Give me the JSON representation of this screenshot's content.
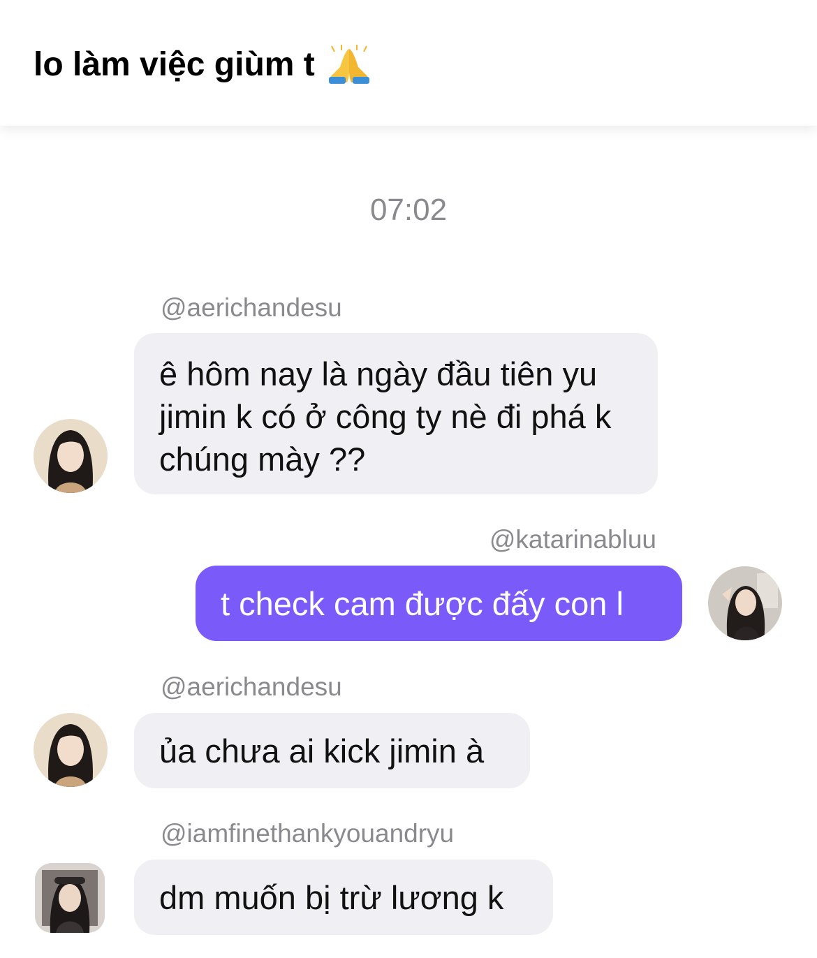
{
  "header": {
    "title": "lo làm việc giùm t",
    "emoji_icon": "folded-hands-icon"
  },
  "timestamp": "07:02",
  "messages": [
    {
      "username": "@aerichandesu",
      "text": "ê hôm nay là ngày đầu tiên yu jimin k có ở công ty nè đi phá k chúng mày ??",
      "direction": "incoming"
    },
    {
      "username": "@katarinabluu",
      "text": "t check cam được đấy con l",
      "direction": "outgoing"
    },
    {
      "username": "@aerichandesu",
      "text": "ủa chưa ai kick jimin à",
      "direction": "incoming"
    },
    {
      "username": "@iamfinethankyouandryu",
      "text": "dm muốn bị trừ lương k",
      "direction": "incoming"
    }
  ],
  "colors": {
    "outgoing_bubble": "#7a5af8",
    "incoming_bubble": "#efeff4",
    "meta_text": "#8a8a8e"
  }
}
